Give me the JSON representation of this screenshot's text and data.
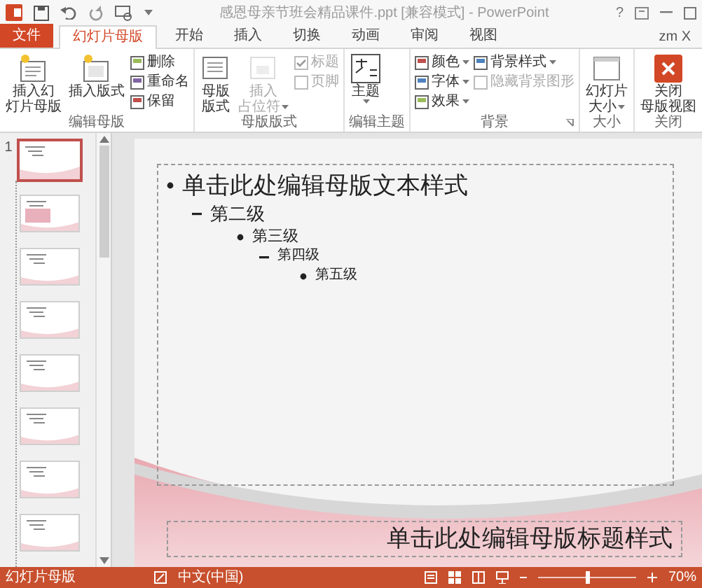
{
  "window": {
    "title": "感恩母亲节班会精品课件.ppt [兼容模式] - PowerPoint",
    "help": "?",
    "account": "zm X"
  },
  "tabs": [
    {
      "label": "文件",
      "kind": "file",
      "selected": false
    },
    {
      "label": "幻灯片母版",
      "kind": "tab",
      "selected": true
    },
    {
      "label": "开始",
      "kind": "tab",
      "selected": false
    },
    {
      "label": "插入",
      "kind": "tab",
      "selected": false
    },
    {
      "label": "切换",
      "kind": "tab",
      "selected": false
    },
    {
      "label": "动画",
      "kind": "tab",
      "selected": false
    },
    {
      "label": "审阅",
      "kind": "tab",
      "selected": false
    },
    {
      "label": "视图",
      "kind": "tab",
      "selected": false
    }
  ],
  "ribbon_groups": [
    {
      "label": "编辑母版",
      "columns": [
        {
          "kind": "large",
          "lines": [
            "插入幻",
            "灯片母版"
          ],
          "disabled": false,
          "dropdown": false
        },
        {
          "kind": "large",
          "lines": [
            "插入版式"
          ],
          "disabled": false,
          "dropdown": false
        },
        {
          "kind": "stack",
          "entries": [
            {
              "kind": "small",
              "label": "删除",
              "disabled": false,
              "dropdown": false
            },
            {
              "kind": "small",
              "label": "重命名",
              "disabled": false,
              "dropdown": false
            },
            {
              "kind": "small",
              "label": "保留",
              "disabled": false,
              "dropdown": false
            }
          ]
        }
      ]
    },
    {
      "label": "母版版式",
      "columns": [
        {
          "kind": "large",
          "lines": [
            "母版",
            "版式"
          ],
          "disabled": false,
          "dropdown": false
        },
        {
          "kind": "large",
          "lines": [
            "插入",
            "占位符"
          ],
          "disabled": true,
          "dropdown": true
        },
        {
          "kind": "stack",
          "entries": [
            {
              "kind": "check",
              "label": "标题",
              "checked": true,
              "disabled": true
            },
            {
              "kind": "check",
              "label": "页脚",
              "checked": false,
              "disabled": true
            }
          ]
        }
      ]
    },
    {
      "label": "编辑主题",
      "columns": [
        {
          "kind": "large",
          "lines": [
            "主题"
          ],
          "disabled": false,
          "dropdown": true
        }
      ]
    },
    {
      "label": "背景",
      "launcher": true,
      "columns": [
        {
          "kind": "stack",
          "entries": [
            {
              "kind": "small",
              "label": "颜色",
              "disabled": false,
              "dropdown": true
            },
            {
              "kind": "small",
              "label": "字体",
              "disabled": false,
              "dropdown": true
            },
            {
              "kind": "small",
              "label": "效果",
              "disabled": false,
              "dropdown": true
            }
          ]
        },
        {
          "kind": "stack",
          "entries": [
            {
              "kind": "small",
              "label": "背景样式",
              "disabled": false,
              "dropdown": true
            },
            {
              "kind": "check",
              "label": "隐藏背景图形",
              "checked": false,
              "disabled": true
            }
          ]
        }
      ]
    },
    {
      "label": "大小",
      "columns": [
        {
          "kind": "large",
          "lines": [
            "幻灯片",
            "大小"
          ],
          "disabled": false,
          "dropdown": true
        }
      ]
    },
    {
      "label": "关闭",
      "columns": [
        {
          "kind": "large",
          "lines": [
            "关闭",
            "母版视图"
          ],
          "disabled": false,
          "dropdown": false
        }
      ]
    }
  ],
  "thumbnails": [
    {
      "number": "1",
      "selected": true
    },
    {
      "selected": false
    },
    {
      "selected": false
    },
    {
      "selected": false
    },
    {
      "selected": false
    },
    {
      "selected": false
    },
    {
      "selected": false
    },
    {
      "selected": false
    }
  ],
  "slide": {
    "body": [
      {
        "text": "单击此处编辑母版文本样式",
        "children": [
          {
            "text": "第二级",
            "children": [
              {
                "text": "第三级",
                "children": [
                  {
                    "text": "第四级",
                    "children": [
                      {
                        "text": "第五级"
                      }
                    ]
                  }
                ]
              }
            ]
          }
        ]
      }
    ],
    "title": "单击此处编辑母版标题样式"
  },
  "status_bar": {
    "view": "幻灯片母版",
    "language": "中文(中国)",
    "zoom": "70%",
    "zoom_slider": {
      "level": 0.5
    }
  }
}
